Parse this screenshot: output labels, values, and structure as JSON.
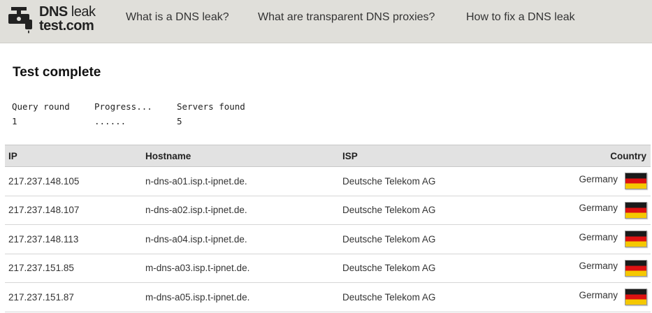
{
  "header": {
    "logo_line1_bold": "DNS",
    "logo_line1_light": " leak",
    "logo_line2": "test.com",
    "nav": [
      "What is a DNS leak?",
      "What are transparent DNS proxies?",
      "How to fix a DNS leak"
    ]
  },
  "main": {
    "title": "Test complete",
    "stats": {
      "query_round_label": "Query round",
      "query_round_value": "1",
      "progress_label": "Progress...",
      "progress_value": "......",
      "servers_label": "Servers found",
      "servers_value": "5"
    },
    "table": {
      "headers": [
        "IP",
        "Hostname",
        "ISP",
        "Country"
      ],
      "rows": [
        {
          "ip": "217.237.148.105",
          "hostname": "n-dns-a01.isp.t-ipnet.de.",
          "isp": "Deutsche Telekom AG",
          "country": "Germany"
        },
        {
          "ip": "217.237.148.107",
          "hostname": "n-dns-a02.isp.t-ipnet.de.",
          "isp": "Deutsche Telekom AG",
          "country": "Germany"
        },
        {
          "ip": "217.237.148.113",
          "hostname": "n-dns-a04.isp.t-ipnet.de.",
          "isp": "Deutsche Telekom AG",
          "country": "Germany"
        },
        {
          "ip": "217.237.151.85",
          "hostname": "m-dns-a03.isp.t-ipnet.de.",
          "isp": "Deutsche Telekom AG",
          "country": "Germany"
        },
        {
          "ip": "217.237.151.87",
          "hostname": "m-dns-a05.isp.t-ipnet.de.",
          "isp": "Deutsche Telekom AG",
          "country": "Germany"
        }
      ]
    }
  },
  "icons": {
    "logo": "leaking-tap-icon",
    "flag": "germany-flag-icon"
  },
  "colors": {
    "header_bg": "#e0dfda",
    "table_header_bg": "#e2e2e2",
    "flag_black": "#1a1a1a",
    "flag_red": "#dd1111",
    "flag_gold": "#f5c800"
  }
}
